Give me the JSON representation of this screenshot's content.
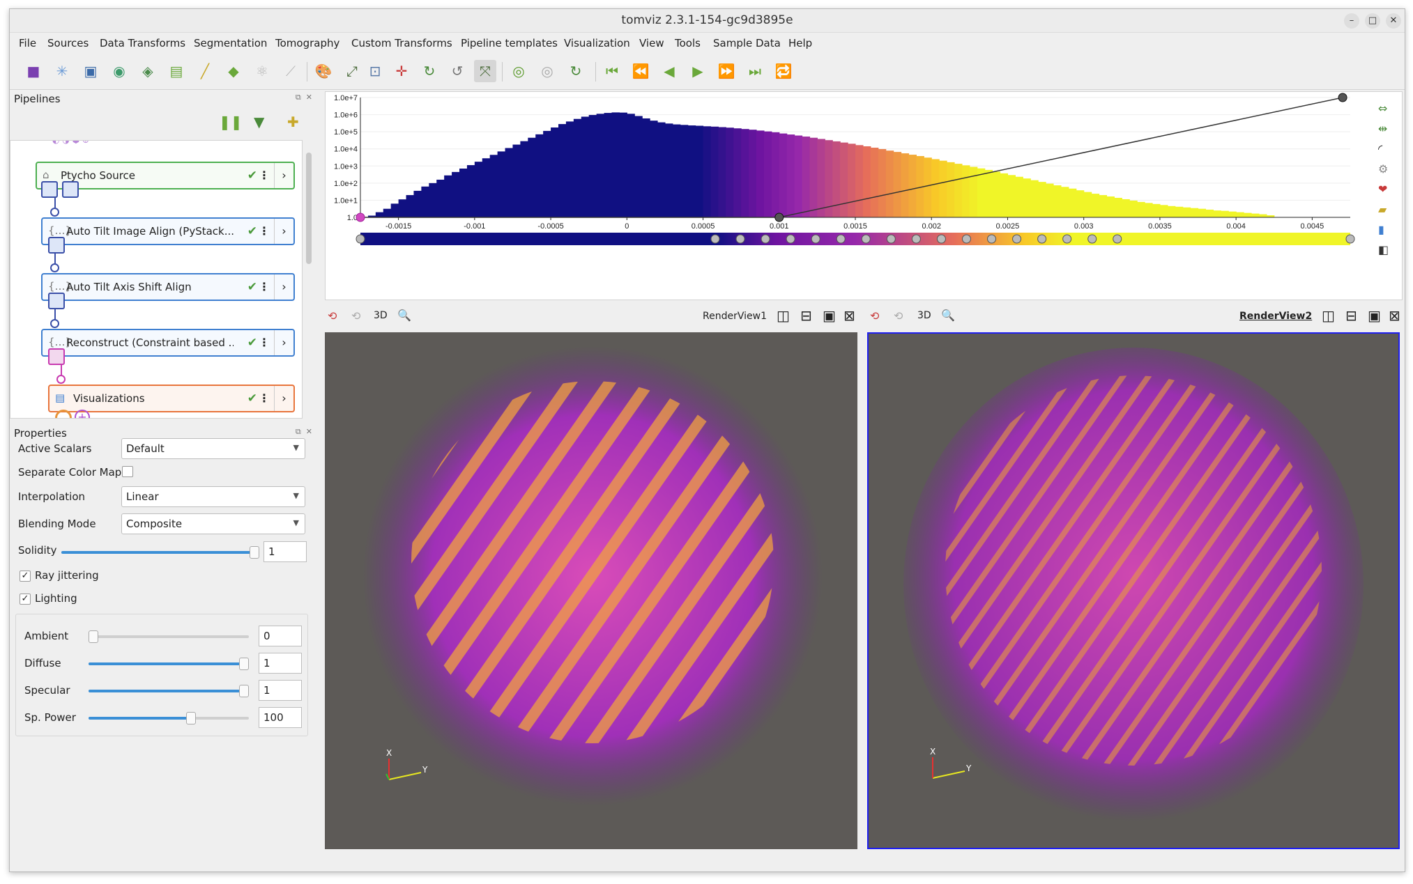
{
  "window": {
    "title": "tomviz 2.3.1-154-gc9d3895e"
  },
  "menubar": [
    "File",
    "Sources",
    "Data Transforms",
    "Segmentation",
    "Tomography",
    "Custom Transforms",
    "Pipeline templates",
    "Visualization",
    "View",
    "Tools",
    "Sample Data",
    "Help"
  ],
  "pipelines": {
    "header": "Pipelines",
    "nodes": [
      {
        "label": "Ptycho Source"
      },
      {
        "label": "Auto Tilt Image Align (PyStack..."
      },
      {
        "label": "Auto Tilt Axis Shift Align"
      },
      {
        "label": "Reconstruct (Constraint based ..."
      },
      {
        "label": "Visualizations"
      }
    ]
  },
  "properties": {
    "header": "Properties",
    "active_scalars": {
      "label": "Active Scalars",
      "value": "Default"
    },
    "separate_color_map": {
      "label": "Separate Color Map",
      "checked": false
    },
    "interpolation": {
      "label": "Interpolation",
      "value": "Linear"
    },
    "blending_mode": {
      "label": "Blending Mode",
      "value": "Composite"
    },
    "solidity": {
      "label": "Solidity",
      "value": "1",
      "level": 1.0
    },
    "ray_jittering": {
      "label": "Ray jittering",
      "checked": true
    },
    "lighting": {
      "label": "Lighting",
      "checked": true
    },
    "ambient": {
      "label": "Ambient",
      "value": "0",
      "level": 0.0
    },
    "diffuse": {
      "label": "Diffuse",
      "value": "1",
      "level": 1.0
    },
    "specular": {
      "label": "Specular",
      "value": "1",
      "level": 1.0
    },
    "sp_power": {
      "label": "Sp. Power",
      "value": "100",
      "level": 0.65
    }
  },
  "colormap": {
    "y_ticks": [
      "1.0e+7",
      "1.0e+6",
      "1.0e+5",
      "1.0e+4",
      "1.0e+3",
      "1.0e+2",
      "1.0e+1",
      "1.0"
    ],
    "x_ticks": [
      "-0.0015",
      "-0.001",
      "-0.0005",
      "0",
      "0.0005",
      "0.001",
      "0.0015",
      "0.002",
      "0.0025",
      "0.003",
      "0.0035",
      "0.004",
      "0.0045"
    ]
  },
  "chart_data": {
    "type": "bar",
    "xlim": [
      -0.00175,
      0.00475
    ],
    "ylim_log10": [
      0,
      7
    ],
    "x": [
      -0.0017,
      -0.00165,
      -0.0016,
      -0.00155,
      -0.0015,
      -0.00145,
      -0.0014,
      -0.00135,
      -0.0013,
      -0.00125,
      -0.0012,
      -0.00115,
      -0.0011,
      -0.00105,
      -0.001,
      -0.00095,
      -0.0009,
      -0.00085,
      -0.0008,
      -0.00075,
      -0.0007,
      -0.00065,
      -0.0006,
      -0.00055,
      -0.0005,
      -0.00045,
      -0.0004,
      -0.00035,
      -0.0003,
      -0.00025,
      -0.0002,
      -0.00015,
      -0.0001,
      -5e-05,
      0,
      5e-05,
      0.0001,
      0.00015,
      0.0002,
      0.00025,
      0.0003,
      0.00035,
      0.0004,
      0.00045,
      0.0005,
      0.00055,
      0.0006,
      0.00065,
      0.0007,
      0.00075,
      0.0008,
      0.00085,
      0.0009,
      0.00095,
      0.001,
      0.00105,
      0.0011,
      0.00115,
      0.0012,
      0.00125,
      0.0013,
      0.00135,
      0.0014,
      0.00145,
      0.0015,
      0.00155,
      0.0016,
      0.00165,
      0.0017,
      0.00175,
      0.0018,
      0.00185,
      0.0019,
      0.00195,
      0.002,
      0.00205,
      0.0021,
      0.00215,
      0.0022,
      0.00225,
      0.0023,
      0.00235,
      0.0024,
      0.00245,
      0.0025,
      0.00255,
      0.0026,
      0.00265,
      0.0027,
      0.00275,
      0.0028,
      0.00285,
      0.0029,
      0.00295,
      0.003,
      0.00305,
      0.0031,
      0.00315,
      0.0032,
      0.00325,
      0.0033,
      0.00335,
      0.0034,
      0.00345,
      0.0035,
      0.00355,
      0.0036,
      0.00365,
      0.0037,
      0.00375,
      0.0038,
      0.00385,
      0.0039,
      0.00395,
      0.004,
      0.00405,
      0.0041,
      0.00415,
      0.0042
    ],
    "values_log10": [
      0.1,
      0.3,
      0.5,
      0.8,
      1.05,
      1.3,
      1.55,
      1.8,
      2.0,
      2.2,
      2.45,
      2.65,
      2.85,
      3.05,
      3.25,
      3.45,
      3.65,
      3.85,
      4.05,
      4.25,
      4.45,
      4.65,
      4.85,
      5.05,
      5.25,
      5.45,
      5.6,
      5.75,
      5.88,
      5.98,
      6.05,
      6.1,
      6.13,
      6.12,
      6.05,
      5.92,
      5.78,
      5.65,
      5.55,
      5.48,
      5.43,
      5.4,
      5.37,
      5.35,
      5.32,
      5.3,
      5.27,
      5.24,
      5.2,
      5.16,
      5.12,
      5.07,
      5.02,
      4.97,
      4.9,
      4.84,
      4.78,
      4.72,
      4.65,
      4.58,
      4.51,
      4.44,
      4.37,
      4.3,
      4.22,
      4.15,
      4.07,
      3.99,
      3.9,
      3.82,
      3.74,
      3.66,
      3.58,
      3.49,
      3.4,
      3.31,
      3.22,
      3.13,
      3.04,
      2.95,
      2.86,
      2.77,
      2.67,
      2.57,
      2.47,
      2.37,
      2.27,
      2.17,
      2.07,
      1.97,
      1.87,
      1.78,
      1.68,
      1.58,
      1.48,
      1.38,
      1.3,
      1.22,
      1.14,
      1.06,
      0.98,
      0.9,
      0.84,
      0.78,
      0.72,
      0.66,
      0.62,
      0.58,
      0.54,
      0.5,
      0.45,
      0.4,
      0.38,
      0.34,
      0.3,
      0.26,
      0.22,
      0.18,
      0.12
    ],
    "opacity_points": [
      [
        0.001,
        0.0
      ],
      [
        0.0047,
        1.0
      ]
    ]
  },
  "renderviews": [
    {
      "name": "RenderView1",
      "mode": "3D",
      "active": false
    },
    {
      "name": "RenderView2",
      "mode": "3D",
      "active": true
    }
  ],
  "colors": {
    "accent": "#3a8fd6",
    "node_green": "#4caf50",
    "node_blue": "#3f7fd0",
    "node_orange": "#e8743b",
    "active_view_border": "#1e1ef0",
    "viewbg": "#5d5a57"
  }
}
